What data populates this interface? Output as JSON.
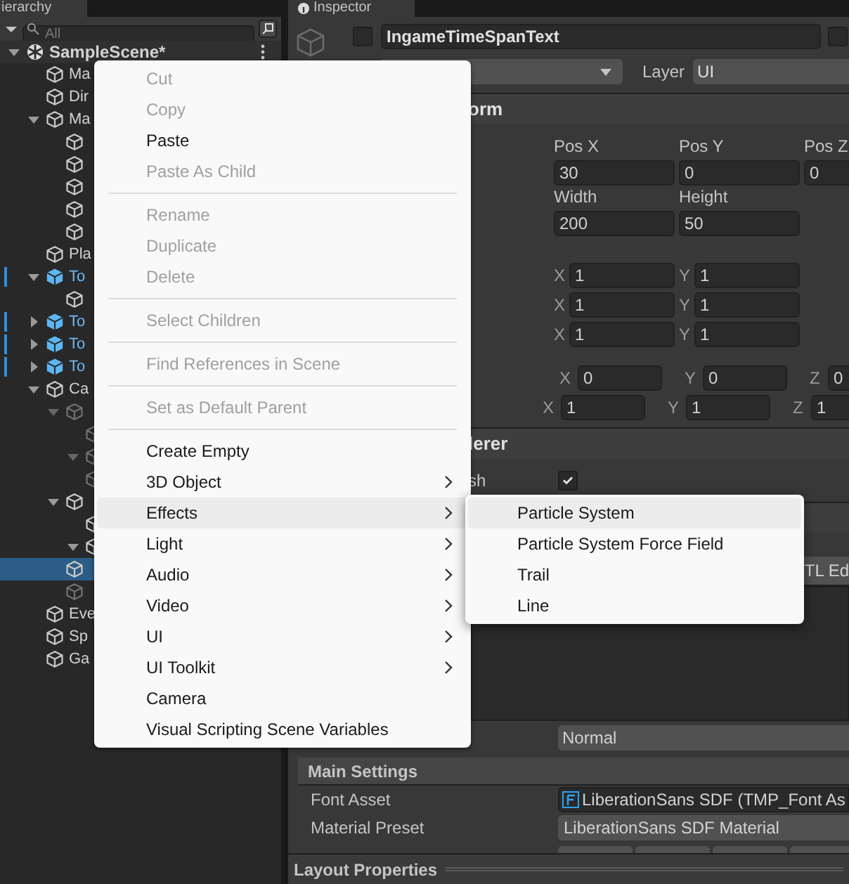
{
  "hierarchy": {
    "tab": "ierarchy",
    "search": {
      "placeholder": "All"
    },
    "tree": [
      {
        "label": "SampleScene*",
        "kind": "scene",
        "expanded": true,
        "selected": false,
        "active": true,
        "children": [
          {
            "label": "Ma",
            "kind": "object",
            "selected": false,
            "active": true
          },
          {
            "label": "Dir",
            "kind": "object",
            "selected": false,
            "active": true
          },
          {
            "label": "Ma",
            "kind": "object",
            "expanded": true,
            "selected": false,
            "active": true,
            "children": [
              {
                "kind": "object",
                "selected": false,
                "active": true
              },
              {
                "kind": "object",
                "selected": false,
                "active": true
              },
              {
                "kind": "object",
                "selected": false,
                "active": true
              },
              {
                "kind": "object",
                "selected": false,
                "active": true
              },
              {
                "kind": "object",
                "selected": false,
                "active": true
              }
            ]
          },
          {
            "label": "Pla",
            "kind": "object",
            "selected": false,
            "active": true
          },
          {
            "label": "To",
            "kind": "prefab",
            "expanded": true,
            "selected": false,
            "active": true,
            "children": [
              {
                "kind": "object",
                "selected": false,
                "active": true
              }
            ]
          },
          {
            "label": "To",
            "kind": "prefab",
            "expanded": false,
            "selected": false,
            "active": true
          },
          {
            "label": "To",
            "kind": "prefab",
            "expanded": false,
            "selected": false,
            "active": true
          },
          {
            "label": "To",
            "kind": "prefab",
            "expanded": false,
            "selected": false,
            "active": true
          },
          {
            "label": "Ca",
            "kind": "object",
            "expanded": true,
            "selected": false,
            "active": true,
            "children": [
              {
                "kind": "object",
                "expanded": true,
                "selected": false,
                "active": false,
                "children": [
                  {
                    "kind": "object",
                    "selected": false,
                    "active": false
                  },
                  {
                    "kind": "object",
                    "expanded": true,
                    "selected": false,
                    "active": false
                  },
                  {
                    "kind": "object",
                    "selected": false,
                    "active": false
                  }
                ]
              },
              {
                "kind": "object",
                "expanded": true,
                "selected": false,
                "active": true,
                "children": [
                  {
                    "kind": "object",
                    "selected": false,
                    "active": true
                  },
                  {
                    "kind": "object",
                    "expanded": true,
                    "selected": false,
                    "active": true
                  }
                ]
              },
              {
                "kind": "object",
                "selected": true,
                "active": true
              },
              {
                "kind": "object",
                "selected": false,
                "active": false
              }
            ]
          },
          {
            "label": "Eve",
            "kind": "object",
            "selected": false,
            "active": true
          },
          {
            "label": "Sp",
            "kind": "object",
            "selected": false,
            "active": true
          },
          {
            "label": "Ga",
            "kind": "object",
            "selected": false,
            "active": true
          }
        ]
      }
    ]
  },
  "inspector": {
    "tab": "Inspector",
    "object": {
      "active": false,
      "name": "IngameTimeSpanText",
      "static": false
    },
    "layer": {
      "label": "Layer",
      "value": "UI"
    },
    "rect_transform": {
      "title": "orm",
      "position": [
        {
          "label": "Pos X",
          "value": "30"
        },
        {
          "label": "Pos Y",
          "value": "0"
        },
        {
          "label": "Pos Z",
          "value": "0"
        }
      ],
      "size": [
        {
          "label": "Width",
          "value": "200"
        },
        {
          "label": "Height",
          "value": "50"
        }
      ],
      "pairs": [
        [
          {
            "axis": "X",
            "value": "1"
          },
          {
            "axis": "Y",
            "value": "1"
          }
        ],
        [
          {
            "axis": "X",
            "value": "1"
          },
          {
            "axis": "Y",
            "value": "1"
          }
        ],
        [
          {
            "axis": "X",
            "value": "1"
          },
          {
            "axis": "Y",
            "value": "1"
          }
        ]
      ],
      "rotation": [
        {
          "axis": "X",
          "value": "0"
        },
        {
          "axis": "Y",
          "value": "0"
        },
        {
          "axis": "Z",
          "value": "0"
        }
      ],
      "scale": [
        {
          "axis": "X",
          "value": "1"
        },
        {
          "axis": "Y",
          "value": "1"
        },
        {
          "axis": "Z",
          "value": "1"
        }
      ]
    },
    "canvas_renderer": {
      "title": "lerer",
      "option": {
        "label": "sh",
        "checked": true
      }
    },
    "toolbar": {
      "button": "TL Ed"
    },
    "style_value": "Normal",
    "main_settings": {
      "title": "Main Settings",
      "rows": [
        {
          "label": "Font Asset",
          "value": "LiberationSans SDF (TMP_Font As",
          "kind": "asset"
        },
        {
          "label": "Material Preset",
          "value": "LiberationSans SDF Material",
          "kind": "dropdown"
        }
      ]
    },
    "footer": "Layout Properties"
  },
  "context_menu": {
    "items": [
      {
        "kind": "item",
        "label": "Cut",
        "disabled": true,
        "submenu": false,
        "selected": false
      },
      {
        "kind": "item",
        "label": "Copy",
        "disabled": true,
        "submenu": false,
        "selected": false
      },
      {
        "kind": "item",
        "label": "Paste",
        "disabled": false,
        "submenu": false,
        "selected": false
      },
      {
        "kind": "item",
        "label": "Paste As Child",
        "disabled": true,
        "submenu": false,
        "selected": false
      },
      {
        "kind": "separator"
      },
      {
        "kind": "item",
        "label": "Rename",
        "disabled": true,
        "submenu": false,
        "selected": false
      },
      {
        "kind": "item",
        "label": "Duplicate",
        "disabled": true,
        "submenu": false,
        "selected": false
      },
      {
        "kind": "item",
        "label": "Delete",
        "disabled": true,
        "submenu": false,
        "selected": false
      },
      {
        "kind": "separator"
      },
      {
        "kind": "item",
        "label": "Select Children",
        "disabled": true,
        "submenu": false,
        "selected": false
      },
      {
        "kind": "separator"
      },
      {
        "kind": "item",
        "label": "Find References in Scene",
        "disabled": true,
        "submenu": false,
        "selected": false
      },
      {
        "kind": "separator"
      },
      {
        "kind": "item",
        "label": "Set as Default Parent",
        "disabled": true,
        "submenu": false,
        "selected": false
      },
      {
        "kind": "separator"
      },
      {
        "kind": "item",
        "label": "Create Empty",
        "disabled": false,
        "submenu": false,
        "selected": false
      },
      {
        "kind": "item",
        "label": "3D Object",
        "disabled": false,
        "submenu": true,
        "selected": false
      },
      {
        "kind": "item",
        "label": "Effects",
        "disabled": false,
        "submenu": true,
        "selected": true
      },
      {
        "kind": "item",
        "label": "Light",
        "disabled": false,
        "submenu": true,
        "selected": false
      },
      {
        "kind": "item",
        "label": "Audio",
        "disabled": false,
        "submenu": true,
        "selected": false
      },
      {
        "kind": "item",
        "label": "Video",
        "disabled": false,
        "submenu": true,
        "selected": false
      },
      {
        "kind": "item",
        "label": "UI",
        "disabled": false,
        "submenu": true,
        "selected": false
      },
      {
        "kind": "item",
        "label": "UI Toolkit",
        "disabled": false,
        "submenu": true,
        "selected": false
      },
      {
        "kind": "item",
        "label": "Camera",
        "disabled": false,
        "submenu": false,
        "selected": false
      },
      {
        "kind": "item",
        "label": "Visual Scripting Scene Variables",
        "disabled": false,
        "submenu": false,
        "selected": false
      }
    ]
  },
  "submenu": {
    "items": [
      {
        "label": "Particle System",
        "selected": true
      },
      {
        "label": "Particle System Force Field",
        "selected": false
      },
      {
        "label": "Trail",
        "selected": false
      },
      {
        "label": "Line",
        "selected": false
      }
    ]
  }
}
